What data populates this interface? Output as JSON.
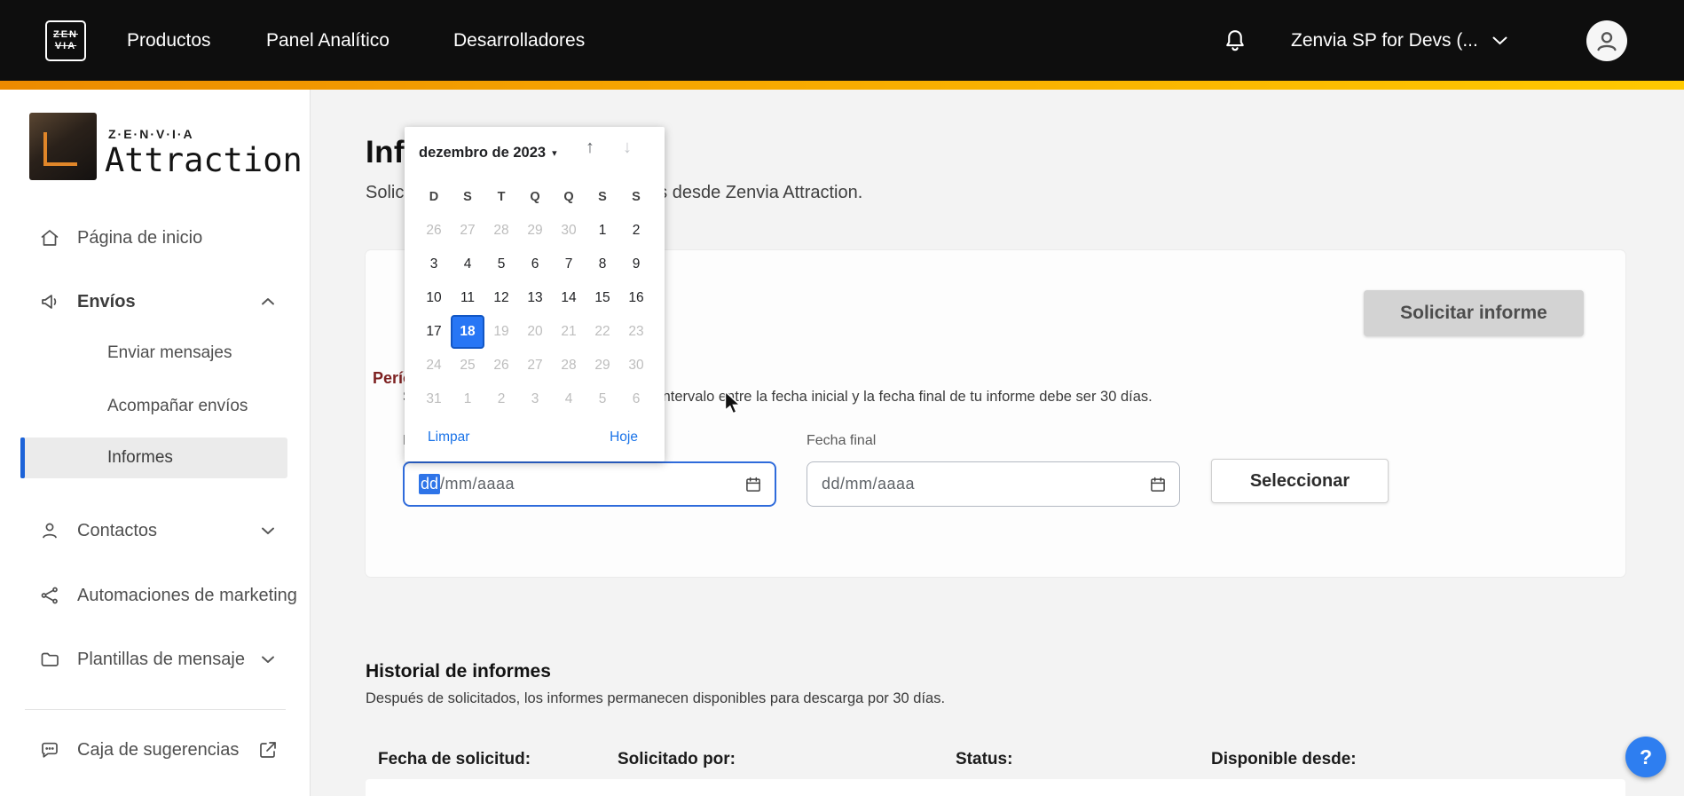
{
  "navbar": {
    "logo_top": "ZEN",
    "logo_bottom": "VIA",
    "items": [
      {
        "label": "Productos"
      },
      {
        "label": "Panel Analítico"
      },
      {
        "label": "Desarrolladores"
      }
    ],
    "account_label": "Zenvia SP for Devs (..."
  },
  "sidebar": {
    "brand_name": "Z·E·N·V·I·A",
    "brand_product": "Attraction",
    "items": {
      "home": "Página de inicio",
      "envios": "Envíos",
      "enviar_mensajes": "Enviar mensajes",
      "acompanar_envios": "Acompañar envíos",
      "informes": "Informes",
      "contactos": "Contactos",
      "automaciones": "Automaciones de marketing",
      "plantillas": "Plantillas de mensaje",
      "sugerencias": "Caja de sugerencias"
    }
  },
  "main": {
    "title": "Informes de envío",
    "subtitle": "Solicita informes de los envíos hechos desde Zenvia Attraction.",
    "request_button": "Solicitar informe",
    "period_label": "Período",
    "period_help": "Selecciona el período de los envíos. El intervalo entre la fecha inicial y la fecha final de tu informe debe ser 30 días.",
    "fecha_inicial_label": "Fecha inicial",
    "fecha_final_label": "Fecha final",
    "date_placeholder_dd": "dd",
    "date_placeholder_rest": "/mm/aaaa",
    "date_placeholder_full": "dd/mm/aaaa",
    "select_button": "Seleccionar"
  },
  "calendar": {
    "month_label": "dezembro de 2023",
    "caret": "▾",
    "up_arrow": "↑",
    "down_arrow": "↓",
    "weekdays": [
      "D",
      "S",
      "T",
      "Q",
      "Q",
      "S",
      "S"
    ],
    "selected_day": 18,
    "clear_label": "Limpar",
    "today_label": "Hoje",
    "cells": [
      {
        "d": 26,
        "s": "m"
      },
      {
        "d": 27,
        "s": "m"
      },
      {
        "d": 28,
        "s": "m"
      },
      {
        "d": 29,
        "s": "m"
      },
      {
        "d": 30,
        "s": "m"
      },
      {
        "d": 1,
        "s": "n"
      },
      {
        "d": 2,
        "s": "n"
      },
      {
        "d": 3,
        "s": "n"
      },
      {
        "d": 4,
        "s": "n"
      },
      {
        "d": 5,
        "s": "n"
      },
      {
        "d": 6,
        "s": "n"
      },
      {
        "d": 7,
        "s": "n"
      },
      {
        "d": 8,
        "s": "n"
      },
      {
        "d": 9,
        "s": "n"
      },
      {
        "d": 10,
        "s": "n"
      },
      {
        "d": 11,
        "s": "n"
      },
      {
        "d": 12,
        "s": "n"
      },
      {
        "d": 13,
        "s": "n"
      },
      {
        "d": 14,
        "s": "n"
      },
      {
        "d": 15,
        "s": "n"
      },
      {
        "d": 16,
        "s": "n"
      },
      {
        "d": 17,
        "s": "n"
      },
      {
        "d": 18,
        "s": "sel"
      },
      {
        "d": 19,
        "s": "m"
      },
      {
        "d": 20,
        "s": "m"
      },
      {
        "d": 21,
        "s": "m"
      },
      {
        "d": 22,
        "s": "m"
      },
      {
        "d": 23,
        "s": "m"
      },
      {
        "d": 24,
        "s": "m"
      },
      {
        "d": 25,
        "s": "m"
      },
      {
        "d": 26,
        "s": "m"
      },
      {
        "d": 27,
        "s": "m"
      },
      {
        "d": 28,
        "s": "m"
      },
      {
        "d": 29,
        "s": "m"
      },
      {
        "d": 30,
        "s": "m"
      },
      {
        "d": 31,
        "s": "m"
      },
      {
        "d": 1,
        "s": "m"
      },
      {
        "d": 2,
        "s": "m"
      },
      {
        "d": 3,
        "s": "m"
      },
      {
        "d": 4,
        "s": "m"
      },
      {
        "d": 5,
        "s": "m"
      },
      {
        "d": 6,
        "s": "m"
      }
    ]
  },
  "history": {
    "title": "Historial de informes",
    "subtitle": "Después de solicitados, los informes permanecen disponibles para descarga por 30 días.",
    "columns": [
      "Fecha de solicitud:",
      "Solicitado por:",
      "Status:",
      "Disponible desde:"
    ]
  },
  "help_button": "?"
}
